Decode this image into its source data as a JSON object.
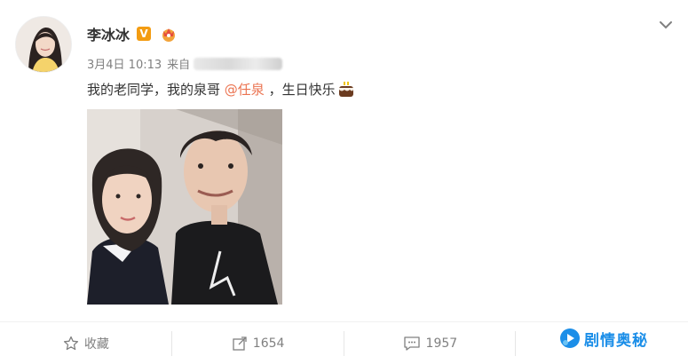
{
  "post": {
    "user": {
      "name": "李冰冰",
      "verified_badge": "V"
    },
    "meta": {
      "date": "3月4日 10:13",
      "source_prefix": "来自"
    },
    "content": {
      "text_before": "我的老同学，我的泉哥 ",
      "mention": "@任泉",
      "text_after": " ，生日快乐"
    },
    "icons": {
      "avatar": "avatar-icon",
      "verified": "verified-badge-icon",
      "member": "member-crown-icon",
      "menu": "chevron-down-icon",
      "cake": "birthday-cake-icon",
      "collect": "star-icon",
      "repost": "repost-icon",
      "comment": "comment-icon"
    }
  },
  "actions": {
    "collect_label": "收藏",
    "repost_count": "1654",
    "comment_count": "1957"
  },
  "watermark": {
    "text": "剧情奥秘"
  },
  "colors": {
    "mention": "#eb7350",
    "meta": "#808080",
    "watermark": "#1b8ee8",
    "badge": "#f39c12"
  }
}
